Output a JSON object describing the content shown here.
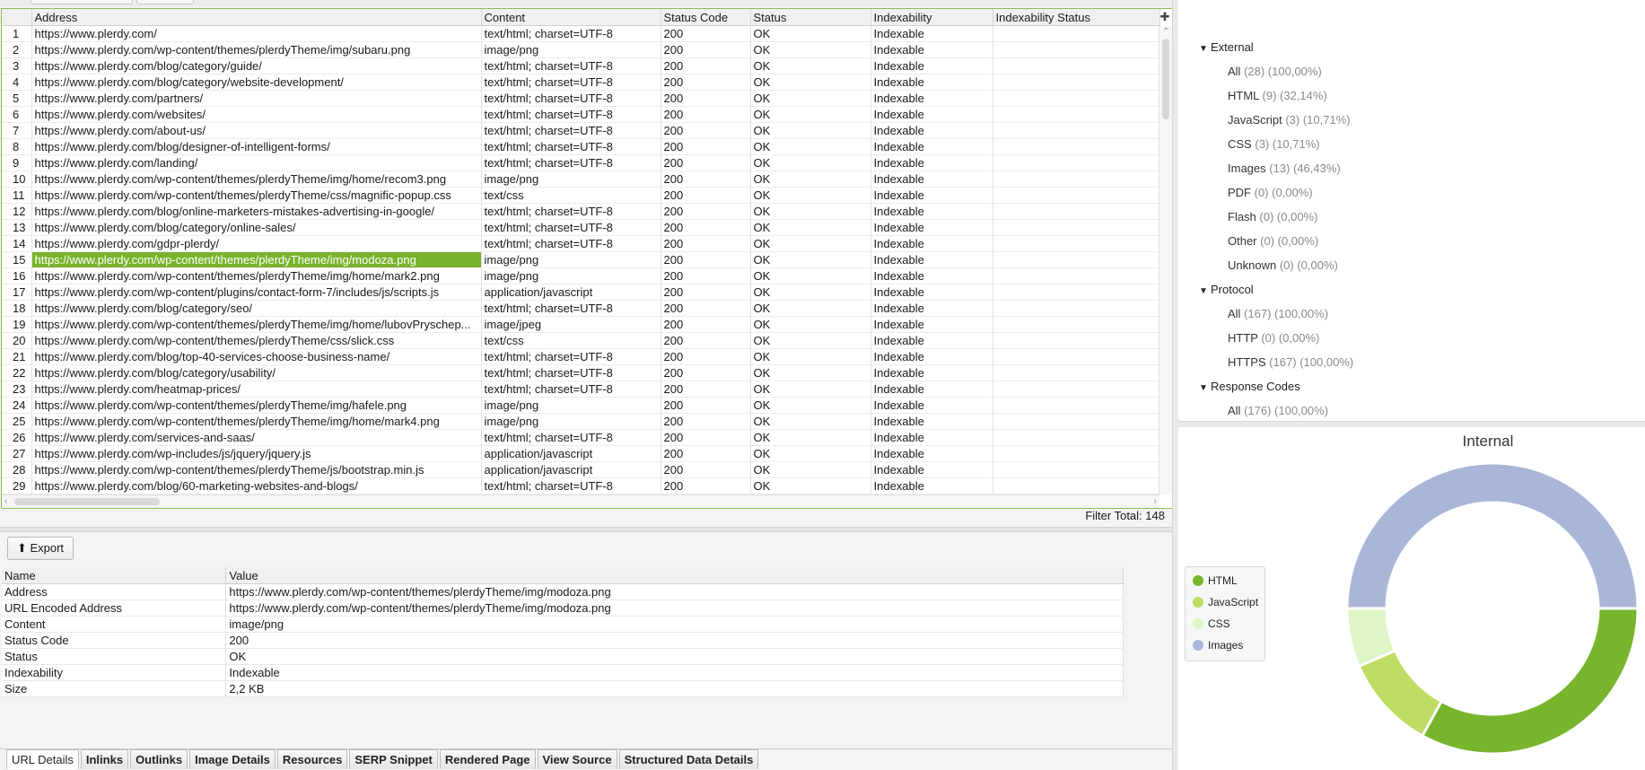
{
  "grid": {
    "columns": [
      "Address",
      "Content",
      "Status Code",
      "Status",
      "Indexability",
      "Indexability Status"
    ],
    "selected_row": 15,
    "rows": [
      [
        "1",
        "https://www.plerdy.com/",
        "text/html; charset=UTF-8",
        "200",
        "OK",
        "Indexable",
        ""
      ],
      [
        "2",
        "https://www.plerdy.com/wp-content/themes/plerdyTheme/img/subaru.png",
        "image/png",
        "200",
        "OK",
        "Indexable",
        ""
      ],
      [
        "3",
        "https://www.plerdy.com/blog/category/guide/",
        "text/html; charset=UTF-8",
        "200",
        "OK",
        "Indexable",
        ""
      ],
      [
        "4",
        "https://www.plerdy.com/blog/category/website-development/",
        "text/html; charset=UTF-8",
        "200",
        "OK",
        "Indexable",
        ""
      ],
      [
        "5",
        "https://www.plerdy.com/partners/",
        "text/html; charset=UTF-8",
        "200",
        "OK",
        "Indexable",
        ""
      ],
      [
        "6",
        "https://www.plerdy.com/websites/",
        "text/html; charset=UTF-8",
        "200",
        "OK",
        "Indexable",
        ""
      ],
      [
        "7",
        "https://www.plerdy.com/about-us/",
        "text/html; charset=UTF-8",
        "200",
        "OK",
        "Indexable",
        ""
      ],
      [
        "8",
        "https://www.plerdy.com/blog/designer-of-intelligent-forms/",
        "text/html; charset=UTF-8",
        "200",
        "OK",
        "Indexable",
        ""
      ],
      [
        "9",
        "https://www.plerdy.com/landing/",
        "text/html; charset=UTF-8",
        "200",
        "OK",
        "Indexable",
        ""
      ],
      [
        "10",
        "https://www.plerdy.com/wp-content/themes/plerdyTheme/img/home/recom3.png",
        "image/png",
        "200",
        "OK",
        "Indexable",
        ""
      ],
      [
        "11",
        "https://www.plerdy.com/wp-content/themes/plerdyTheme/css/magnific-popup.css",
        "text/css",
        "200",
        "OK",
        "Indexable",
        ""
      ],
      [
        "12",
        "https://www.plerdy.com/blog/online-marketers-mistakes-advertising-in-google/",
        "text/html; charset=UTF-8",
        "200",
        "OK",
        "Indexable",
        ""
      ],
      [
        "13",
        "https://www.plerdy.com/blog/category/online-sales/",
        "text/html; charset=UTF-8",
        "200",
        "OK",
        "Indexable",
        ""
      ],
      [
        "14",
        "https://www.plerdy.com/gdpr-plerdy/",
        "text/html; charset=UTF-8",
        "200",
        "OK",
        "Indexable",
        ""
      ],
      [
        "15",
        "https://www.plerdy.com/wp-content/themes/plerdyTheme/img/modoza.png",
        "image/png",
        "200",
        "OK",
        "Indexable",
        ""
      ],
      [
        "16",
        "https://www.plerdy.com/wp-content/themes/plerdyTheme/img/home/mark2.png",
        "image/png",
        "200",
        "OK",
        "Indexable",
        ""
      ],
      [
        "17",
        "https://www.plerdy.com/wp-content/plugins/contact-form-7/includes/js/scripts.js",
        "application/javascript",
        "200",
        "OK",
        "Indexable",
        ""
      ],
      [
        "18",
        "https://www.plerdy.com/blog/category/seo/",
        "text/html; charset=UTF-8",
        "200",
        "OK",
        "Indexable",
        ""
      ],
      [
        "19",
        "https://www.plerdy.com/wp-content/themes/plerdyTheme/img/home/lubovPryschep...",
        "image/jpeg",
        "200",
        "OK",
        "Indexable",
        ""
      ],
      [
        "20",
        "https://www.plerdy.com/wp-content/themes/plerdyTheme/css/slick.css",
        "text/css",
        "200",
        "OK",
        "Indexable",
        ""
      ],
      [
        "21",
        "https://www.plerdy.com/blog/top-40-services-choose-business-name/",
        "text/html; charset=UTF-8",
        "200",
        "OK",
        "Indexable",
        ""
      ],
      [
        "22",
        "https://www.plerdy.com/blog/category/usability/",
        "text/html; charset=UTF-8",
        "200",
        "OK",
        "Indexable",
        ""
      ],
      [
        "23",
        "https://www.plerdy.com/heatmap-prices/",
        "text/html; charset=UTF-8",
        "200",
        "OK",
        "Indexable",
        ""
      ],
      [
        "24",
        "https://www.plerdy.com/wp-content/themes/plerdyTheme/img/hafele.png",
        "image/png",
        "200",
        "OK",
        "Indexable",
        ""
      ],
      [
        "25",
        "https://www.plerdy.com/wp-content/themes/plerdyTheme/img/home/mark4.png",
        "image/png",
        "200",
        "OK",
        "Indexable",
        ""
      ],
      [
        "26",
        "https://www.plerdy.com/services-and-saas/",
        "text/html; charset=UTF-8",
        "200",
        "OK",
        "Indexable",
        ""
      ],
      [
        "27",
        "https://www.plerdy.com/wp-includes/js/jquery/jquery.js",
        "application/javascript",
        "200",
        "OK",
        "Indexable",
        ""
      ],
      [
        "28",
        "https://www.plerdy.com/wp-content/themes/plerdyTheme/js/bootstrap.min.js",
        "application/javascript",
        "200",
        "OK",
        "Indexable",
        ""
      ],
      [
        "29",
        "https://www.plerdy.com/blog/60-marketing-websites-and-blogs/",
        "text/html; charset=UTF-8",
        "200",
        "OK",
        "Indexable",
        ""
      ]
    ]
  },
  "filter_total": {
    "label": "Filter Total:",
    "value": "148"
  },
  "export_label": "Export",
  "details": {
    "columns": [
      "Name",
      "Value"
    ],
    "rows": [
      [
        "Address",
        "https://www.plerdy.com/wp-content/themes/plerdyTheme/img/modoza.png"
      ],
      [
        "URL Encoded Address",
        "https://www.plerdy.com/wp-content/themes/plerdyTheme/img/modoza.png"
      ],
      [
        "Content",
        "image/png"
      ],
      [
        "Status Code",
        "200"
      ],
      [
        "Status",
        "OK"
      ],
      [
        "Indexability",
        "Indexable"
      ],
      [
        "Size",
        "2,2 KB"
      ]
    ]
  },
  "tabs": [
    "URL Details",
    "Inlinks",
    "Outlinks",
    "Image Details",
    "Resources",
    "SERP Snippet",
    "Rendered Page",
    "View Source",
    "Structured Data Details"
  ],
  "tree": [
    {
      "group": "External",
      "items": [
        {
          "label": "All",
          "count": "(28) (100,00%)"
        },
        {
          "label": "HTML",
          "count": "(9) (32,14%)"
        },
        {
          "label": "JavaScript",
          "count": "(3) (10,71%)"
        },
        {
          "label": "CSS",
          "count": "(3) (10,71%)"
        },
        {
          "label": "Images",
          "count": "(13) (46,43%)"
        },
        {
          "label": "PDF",
          "count": "(0) (0,00%)"
        },
        {
          "label": "Flash",
          "count": "(0) (0,00%)"
        },
        {
          "label": "Other",
          "count": "(0) (0,00%)"
        },
        {
          "label": "Unknown",
          "count": "(0) (0,00%)"
        }
      ]
    },
    {
      "group": "Protocol",
      "items": [
        {
          "label": "All",
          "count": "(167) (100,00%)"
        },
        {
          "label": "HTTP",
          "count": "(0) (0,00%)"
        },
        {
          "label": "HTTPS",
          "count": "(167) (100,00%)"
        }
      ]
    },
    {
      "group": "Response Codes",
      "items": [
        {
          "label": "All",
          "count": "(176) (100,00%)"
        }
      ]
    }
  ],
  "chart_data": {
    "type": "pie",
    "title": "Internal",
    "categories": [
      "HTML",
      "JavaScript",
      "CSS",
      "Images"
    ],
    "values": [
      33,
      10.5,
      6.5,
      50
    ],
    "colors": [
      "#77b52d",
      "#bfdc64",
      "#def5c6",
      "#a9b6d8"
    ],
    "legend_position": "left"
  }
}
